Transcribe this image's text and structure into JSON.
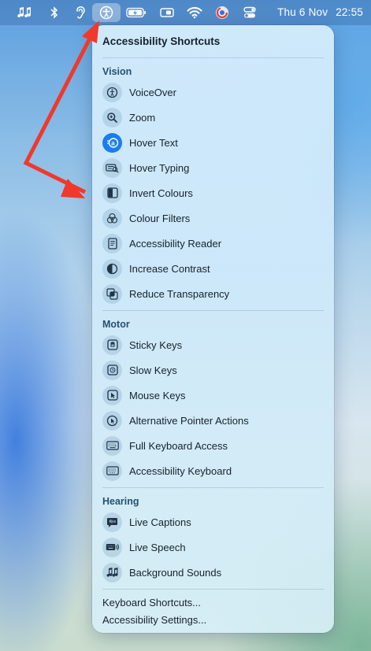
{
  "menubar": {
    "icons": [
      "music-notes-icon",
      "bluetooth-icon",
      "hearing-icon",
      "accessibility-icon",
      "battery-charging-icon",
      "sidecar-icon",
      "wifi-icon",
      "screen-time-icon",
      "control-centre-icon"
    ],
    "date": "Thu 6 Nov",
    "time": "22:55"
  },
  "panel": {
    "title": "Accessibility Shortcuts",
    "sections": [
      {
        "label": "Vision",
        "items": [
          {
            "label": "VoiceOver",
            "icon": "voiceover-icon",
            "active": false
          },
          {
            "label": "Zoom",
            "icon": "zoom-icon",
            "active": false
          },
          {
            "label": "Hover Text",
            "icon": "hover-text-icon",
            "active": true
          },
          {
            "label": "Hover Typing",
            "icon": "hover-typing-icon",
            "active": false
          },
          {
            "label": "Invert Colours",
            "icon": "invert-colours-icon",
            "active": false
          },
          {
            "label": "Colour Filters",
            "icon": "colour-filters-icon",
            "active": false
          },
          {
            "label": "Accessibility Reader",
            "icon": "accessibility-reader-icon",
            "active": false
          },
          {
            "label": "Increase Contrast",
            "icon": "increase-contrast-icon",
            "active": false
          },
          {
            "label": "Reduce Transparency",
            "icon": "reduce-transparency-icon",
            "active": false
          }
        ]
      },
      {
        "label": "Motor",
        "items": [
          {
            "label": "Sticky Keys",
            "icon": "sticky-keys-icon",
            "active": false
          },
          {
            "label": "Slow Keys",
            "icon": "slow-keys-icon",
            "active": false
          },
          {
            "label": "Mouse Keys",
            "icon": "mouse-keys-icon",
            "active": false
          },
          {
            "label": "Alternative Pointer Actions",
            "icon": "alternative-pointer-icon",
            "active": false
          },
          {
            "label": "Full Keyboard Access",
            "icon": "full-keyboard-icon",
            "active": false
          },
          {
            "label": "Accessibility Keyboard",
            "icon": "accessibility-keyboard-icon",
            "active": false
          }
        ]
      },
      {
        "label": "Hearing",
        "items": [
          {
            "label": "Live Captions",
            "icon": "live-captions-icon",
            "active": false
          },
          {
            "label": "Live Speech",
            "icon": "live-speech-icon",
            "active": false
          },
          {
            "label": "Background Sounds",
            "icon": "background-sounds-icon",
            "active": false
          }
        ]
      }
    ],
    "footer": {
      "keyboard_shortcuts": "Keyboard Shortcuts...",
      "accessibility_settings": "Accessibility Settings..."
    }
  },
  "annotation": {
    "color": "#f0392b"
  }
}
